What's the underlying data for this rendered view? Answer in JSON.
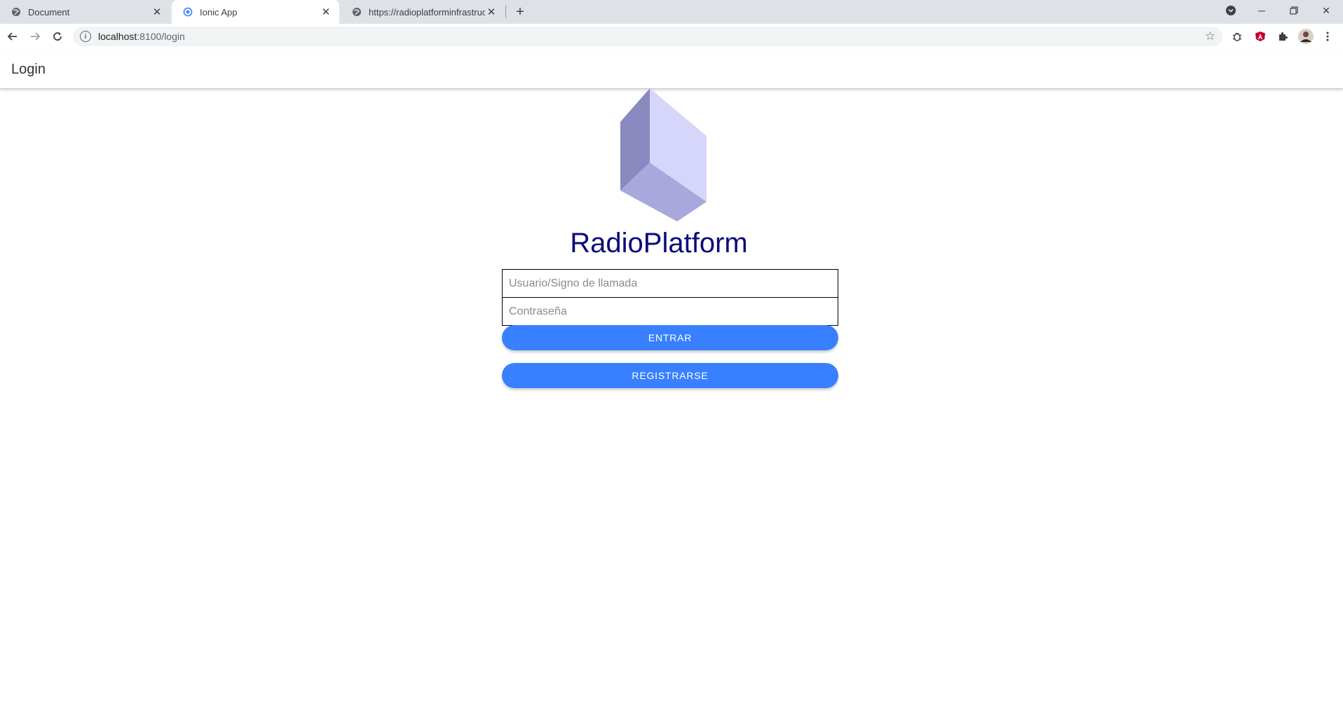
{
  "browser": {
    "tabs": [
      {
        "title": "Document",
        "icon": "globe-icon",
        "active": false
      },
      {
        "title": "Ionic App",
        "icon": "ionic-icon",
        "active": true
      },
      {
        "title": "https://radioplatforminfrastructur",
        "icon": "globe-icon",
        "active": false
      }
    ],
    "url_host": "localhost",
    "url_rest": ":8100/login"
  },
  "app": {
    "header_title": "Login",
    "brand_name": "RadioPlatform",
    "logo_icon": "cube-logo",
    "colors": {
      "brand": "#0b0a7a",
      "primary": "#3880ff"
    },
    "username_placeholder": "Usuario/Signo de llamada",
    "password_placeholder": "Contraseña",
    "login_button": "ENTRAR",
    "register_button": "REGISTRARSE"
  }
}
